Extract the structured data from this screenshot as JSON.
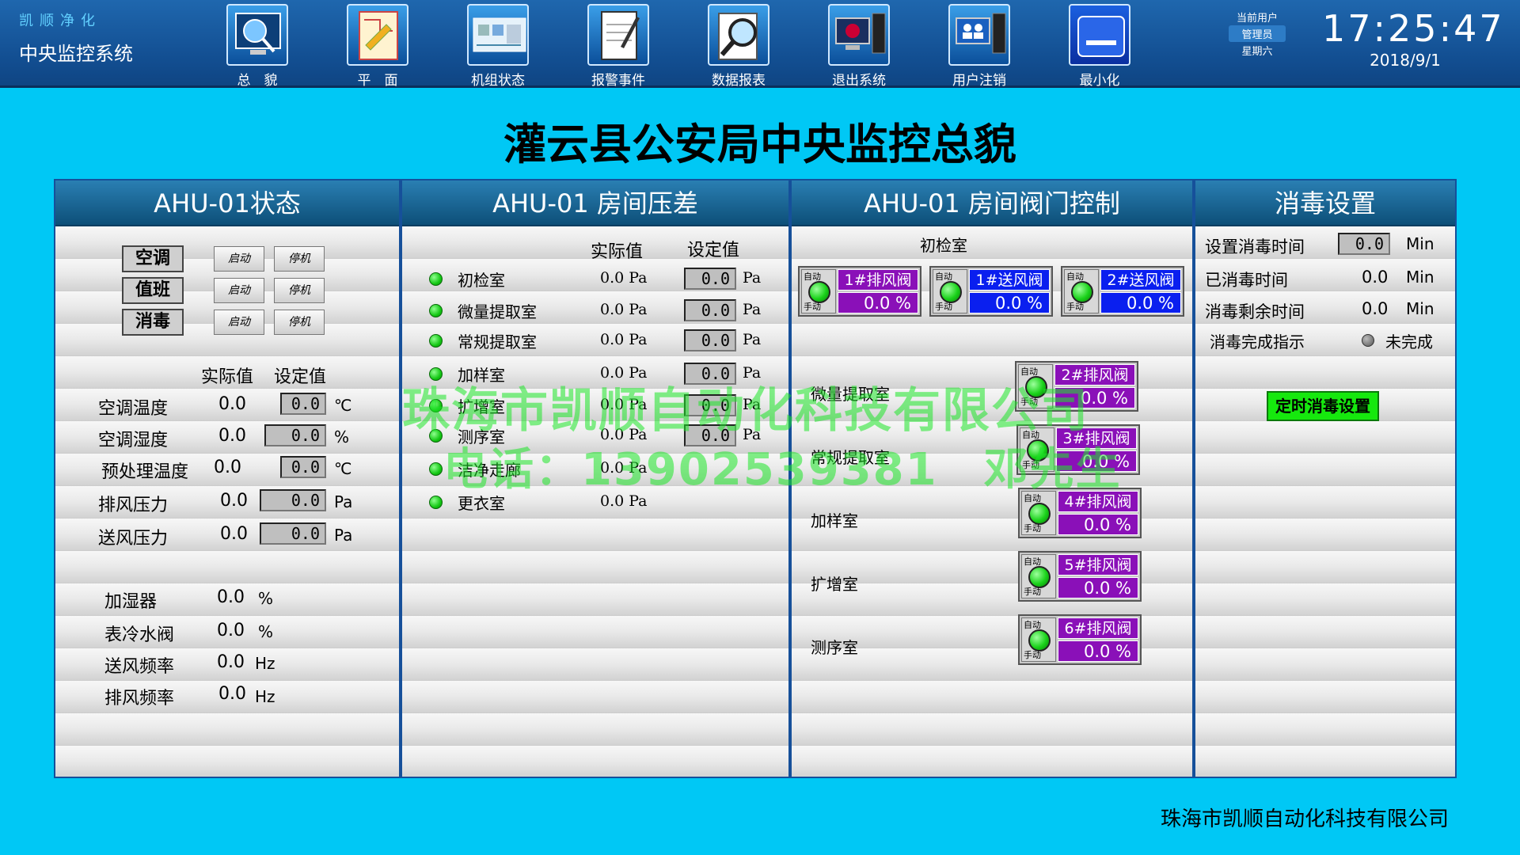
{
  "header": {
    "brand_sub": "凯顺净化",
    "brand_title": "中央监控系统",
    "nav": [
      {
        "label": "总　貌",
        "icon": "monitor-globe-icon"
      },
      {
        "label": "平　面",
        "icon": "floor-plan-icon"
      },
      {
        "label": "机组状态",
        "icon": "unit-status-icon"
      },
      {
        "label": "报警事件",
        "icon": "alarm-notepad-icon"
      },
      {
        "label": "数据报表",
        "icon": "magnifier-report-icon"
      },
      {
        "label": "退出系统",
        "icon": "exit-computer-icon"
      },
      {
        "label": "用户注销",
        "icon": "user-logout-icon"
      },
      {
        "label": "最小化",
        "icon": "minimize-icon"
      }
    ],
    "user_label": "当前用户",
    "user_role": "管理员",
    "weekday": "星期六",
    "time": "17:25:47",
    "date": "2018/9/1"
  },
  "page_title": "灌云县公安局中央监控总貌",
  "status_panel": {
    "title": "AHU-01状态",
    "controls": [
      {
        "name": "空调",
        "start": "启动",
        "stop": "停机"
      },
      {
        "name": "值班",
        "start": "启动",
        "stop": "停机"
      },
      {
        "name": "消毒",
        "start": "启动",
        "stop": "停机"
      }
    ],
    "col_actual": "实际值",
    "col_set": "设定值",
    "params": [
      {
        "label": "空调温度",
        "actual": "0.0",
        "set": "0.0",
        "unit": "℃"
      },
      {
        "label": "空调湿度",
        "actual": "0.0",
        "set": "0.0",
        "unit": "%"
      },
      {
        "label": "预处理温度",
        "actual": "0.0",
        "set": "0.0",
        "unit": "℃"
      },
      {
        "label": "排风压力",
        "actual": "0.0",
        "set": "0.0",
        "unit": "Pa"
      },
      {
        "label": "送风压力",
        "actual": "0.0",
        "set": "0.0",
        "unit": "Pa"
      }
    ],
    "readings": [
      {
        "label": "加湿器",
        "value": "0.0",
        "unit": "%"
      },
      {
        "label": "表冷水阀",
        "value": "0.0",
        "unit": "%"
      },
      {
        "label": "送风频率",
        "value": "0.0",
        "unit": "Hz"
      },
      {
        "label": "排风频率",
        "value": "0.0",
        "unit": "Hz"
      }
    ]
  },
  "pressure_panel": {
    "title": "AHU-01 房间压差",
    "col_actual": "实际值",
    "col_set": "设定值",
    "rooms": [
      {
        "name": "初检室",
        "actual": "0.0 Pa",
        "set": "0.0",
        "unit": "Pa"
      },
      {
        "name": "微量提取室",
        "actual": "0.0 Pa",
        "set": "0.0",
        "unit": "Pa"
      },
      {
        "name": "常规提取室",
        "actual": "0.0 Pa",
        "set": "0.0",
        "unit": "Pa"
      },
      {
        "name": "加样室",
        "actual": "0.0 Pa",
        "set": "0.0",
        "unit": "Pa"
      },
      {
        "name": "扩增室",
        "actual": "0.0 Pa",
        "set": "0.0",
        "unit": "Pa"
      },
      {
        "name": "测序室",
        "actual": "0.0 Pa",
        "set": "0.0",
        "unit": "Pa"
      },
      {
        "name": "洁净走廊",
        "actual": "0.0 Pa",
        "set": "",
        "unit": ""
      },
      {
        "name": "更衣室",
        "actual": "0.0 Pa",
        "set": "",
        "unit": ""
      }
    ]
  },
  "valve_panel": {
    "title": "AHU-01 房间阀门控制",
    "auto_label": "自动",
    "manual_label": "手动",
    "top_room": "初检室",
    "top_valves": [
      {
        "name": "1#排风阀",
        "value": "0.0 %",
        "color": "#8a10b8"
      },
      {
        "name": "1#送风阀",
        "value": "0.0 %",
        "color": "#0a1fef"
      },
      {
        "name": "2#送风阀",
        "value": "0.0 %",
        "color": "#0a1fef"
      }
    ],
    "room_valves": [
      {
        "room": "微量提取室",
        "name": "2#排风阀",
        "value": "0.0 %"
      },
      {
        "room": "常规提取室",
        "name": "3#排风阀",
        "value": "0.0 %"
      },
      {
        "room": "加样室",
        "name": "4#排风阀",
        "value": "0.0 %"
      },
      {
        "room": "扩增室",
        "name": "5#排风阀",
        "value": "0.0 %"
      },
      {
        "room": "测序室",
        "name": "6#排风阀",
        "value": "0.0 %"
      }
    ]
  },
  "disinfect_panel": {
    "title": "消毒设置",
    "set_label": "设置消毒时间",
    "set_value": "0.0",
    "set_unit": "Min",
    "elapsed_label": "已消毒时间",
    "elapsed_value": "0.0",
    "elapsed_unit": "Min",
    "remain_label": "消毒剩余时间",
    "remain_value": "0.0",
    "remain_unit": "Min",
    "done_label": "消毒完成指示",
    "done_status": "未完成",
    "timer_button": "定时消毒设置"
  },
  "watermark": {
    "line1": "珠海市凯顺自动化科技有限公司",
    "line2": "电话：13902539381　邓先生"
  },
  "footer": "珠海市凯顺自动化科技有限公司"
}
